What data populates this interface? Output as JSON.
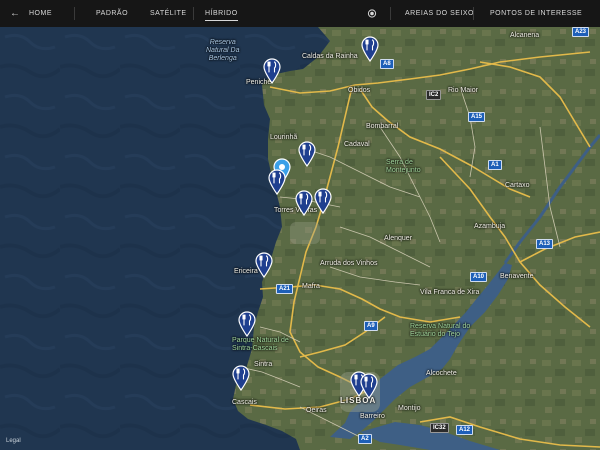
{
  "topbar": {
    "back_label": "HOME",
    "tabs": [
      "PADRÃO",
      "SATÉLITE",
      "HÍBRIDO"
    ],
    "active_tab": "HÍBRIDO",
    "location_label": "AREIAS DO SEIXO",
    "poi_label": "PONTOS DE INTERESSE"
  },
  "map": {
    "legal": "Legal",
    "place_labels": [
      "Reserva\nNatural Da\nBerlenga",
      "Peniche",
      "Caldas da Rainha",
      "Óbidos",
      "Rio Maior",
      "Bombarral",
      "Lourinhã",
      "Cadaval",
      "Torres Vedras",
      "Alenquer",
      "Azambuja",
      "Cartaxo",
      "Ericeira",
      "Mafra",
      "Vila Franca de Xira",
      "Benavente",
      "Parque Natural de\nSintra-Cascais",
      "Sintra",
      "Cascais",
      "Oeiras",
      "LISBOA",
      "Barreiro",
      "Montijo",
      "Alcochete",
      "Alcanena",
      "Reserva Natural do\nEstuário do Tejo",
      "Serra de\nMontejunto",
      "Arruda dos Vinhos"
    ],
    "road_shields": [
      "A8",
      "IC2",
      "A15",
      "A1",
      "A13",
      "A10",
      "A21",
      "A9",
      "IC32",
      "A12",
      "A2",
      "A23"
    ],
    "markers": [
      {
        "name": "restaurant-marker",
        "kind": "fork-knife",
        "color": "#1f3f8f"
      },
      {
        "name": "restaurant-marker",
        "kind": "fork-knife",
        "color": "#1f3f8f"
      },
      {
        "name": "restaurant-marker",
        "kind": "fork-knife",
        "color": "#1f3f8f"
      },
      {
        "name": "current-location-marker",
        "kind": "location",
        "color": "#3aa0e8"
      },
      {
        "name": "restaurant-marker",
        "kind": "fork-knife",
        "color": "#1f3f8f"
      },
      {
        "name": "restaurant-marker",
        "kind": "fork-knife",
        "color": "#1f3f8f"
      },
      {
        "name": "restaurant-marker",
        "kind": "fork-knife",
        "color": "#1f3f8f"
      },
      {
        "name": "restaurant-marker",
        "kind": "fork-knife",
        "color": "#1f3f8f"
      },
      {
        "name": "restaurant-marker",
        "kind": "fork-knife",
        "color": "#1f3f8f"
      },
      {
        "name": "restaurant-marker",
        "kind": "fork-knife",
        "color": "#1f3f8f"
      },
      {
        "name": "restaurant-marker",
        "kind": "fork-knife",
        "color": "#1f3f8f"
      },
      {
        "name": "restaurant-marker",
        "kind": "fork-knife",
        "color": "#1f3f8f"
      }
    ],
    "colors": {
      "ocean": "#1f3550",
      "land": "#5b6b45",
      "estuary": "#3d5f86",
      "road_major": "#e2b94a",
      "road_minor": "#d8d2c0",
      "marker": "#1f3f8f"
    }
  }
}
